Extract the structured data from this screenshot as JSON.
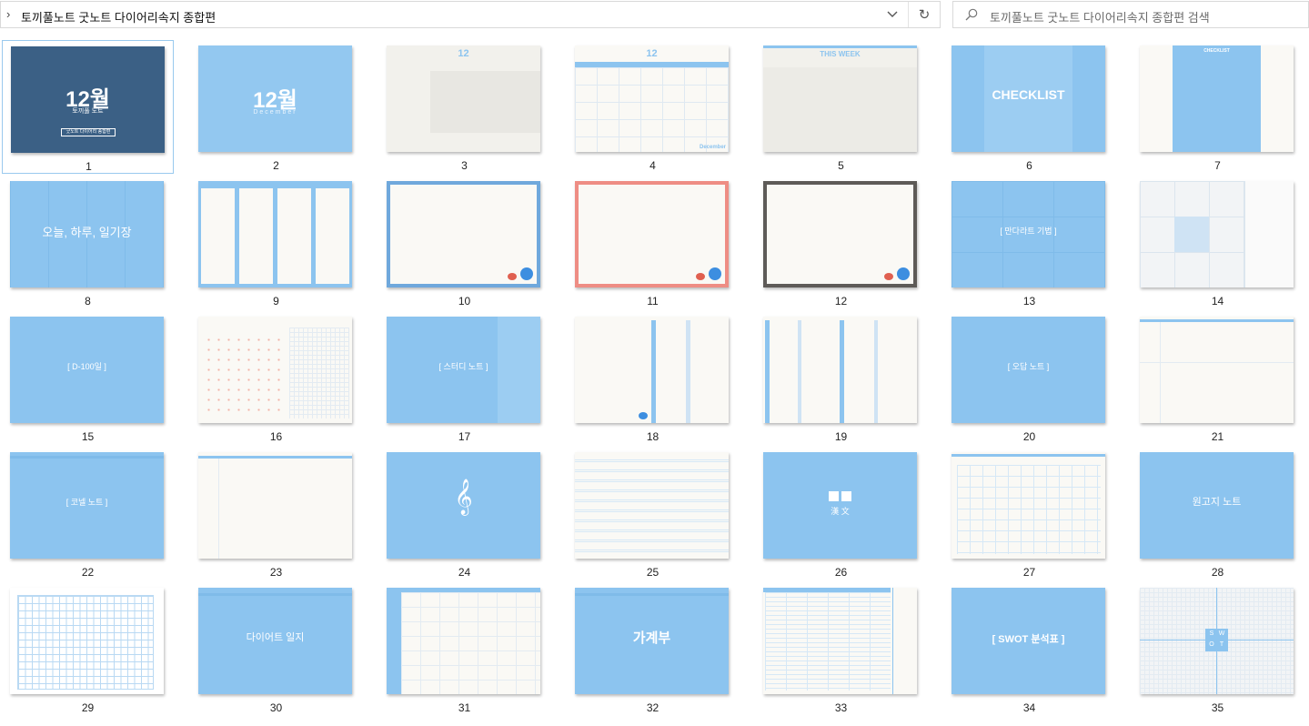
{
  "address_bar": {
    "path": "토끼풀노트 굿노트 다이어리속지 종합편"
  },
  "search": {
    "placeholder": "토끼풀노트 굿노트 다이어리속지 종합편 검색"
  },
  "thumbnail_texts": {
    "t1_title": "12월",
    "t1_sub": "토끼풀 노트",
    "t1_badge": "굿노트 다이어리 종합편",
    "t2_title": "12월",
    "t2_sub": "December",
    "t3_title": "12",
    "t4_title": "12",
    "t4_foot": "December",
    "t5_title": "THIS WEEK",
    "t6_title": "CHECKLIST",
    "t7_title": "CHECKLIST",
    "t8_title": "오늘, 하루, 일기장",
    "t13_title": "[ 만다라트 기법 ]",
    "t15_title": "[ D-100일 ]",
    "t17_title": "[ 스터디 노트 ]",
    "t20_title": "[ 오답 노트 ]",
    "t22_title": "[ 코넬 노트 ]",
    "t24_icon": "𝄞",
    "t26_title": "漢 文",
    "t28_title": "원고지 노트",
    "t30_title": "다이어트 일지",
    "t32_title": "가계부",
    "t34_title": "[ SWOT 분석표 ]",
    "t35_s": "S",
    "t35_w": "W",
    "t35_o": "O",
    "t35_t": "T"
  },
  "files": [
    {
      "label": "1"
    },
    {
      "label": "2"
    },
    {
      "label": "3"
    },
    {
      "label": "4"
    },
    {
      "label": "5"
    },
    {
      "label": "6"
    },
    {
      "label": "7"
    },
    {
      "label": "8"
    },
    {
      "label": "9"
    },
    {
      "label": "10"
    },
    {
      "label": "11"
    },
    {
      "label": "12"
    },
    {
      "label": "13"
    },
    {
      "label": "14"
    },
    {
      "label": "15"
    },
    {
      "label": "16"
    },
    {
      "label": "17"
    },
    {
      "label": "18"
    },
    {
      "label": "19"
    },
    {
      "label": "20"
    },
    {
      "label": "21"
    },
    {
      "label": "22"
    },
    {
      "label": "23"
    },
    {
      "label": "24"
    },
    {
      "label": "25"
    },
    {
      "label": "26"
    },
    {
      "label": "27"
    },
    {
      "label": "28"
    },
    {
      "label": "29"
    },
    {
      "label": "30"
    },
    {
      "label": "31"
    },
    {
      "label": "32"
    },
    {
      "label": "33"
    },
    {
      "label": "34"
    },
    {
      "label": "35"
    }
  ],
  "colors": {
    "accent_blue": "#8cc4ef",
    "selection_border": "#99c9ee",
    "navy": "#3b6085"
  }
}
